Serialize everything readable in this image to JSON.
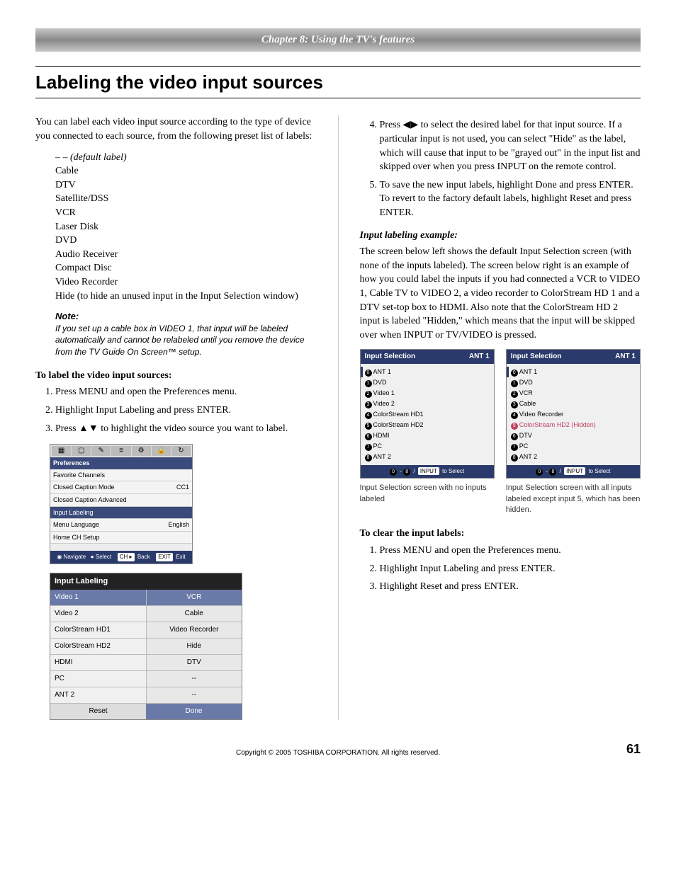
{
  "chapter_banner": "Chapter 8: Using the TV's features",
  "title": "Labeling the video input sources",
  "intro": "You can label each video input source according to the type of device you connected to each source, from the following preset list of labels:",
  "labels": [
    "– – (default label)",
    "Cable",
    "DTV",
    "Satellite/DSS",
    "VCR",
    "Laser Disk",
    "DVD",
    "Audio Receiver",
    "Compact Disc",
    "Video Recorder",
    "Hide (to hide an unused input in the Input Selection window)"
  ],
  "note_head": "Note:",
  "note_body": "If you set up a cable box in VIDEO 1, that input will be labeled automatically and cannot be relabeled until you remove the device from the TV Guide On Screen™ setup.",
  "label_heading": "To label the video input sources:",
  "label_steps": [
    "Press MENU and open the Preferences menu.",
    "Highlight Input Labeling and press ENTER.",
    "Press ▲▼ to highlight the video source you want to label."
  ],
  "prefs": {
    "title": "Preferences",
    "rows": [
      {
        "l": "Favorite Channels",
        "r": ""
      },
      {
        "l": "Closed Caption Mode",
        "r": "CC1"
      },
      {
        "l": "Closed Caption Advanced",
        "r": ""
      },
      {
        "l": "Input Labeling",
        "r": "",
        "sel": true
      },
      {
        "l": "Menu Language",
        "r": "English"
      },
      {
        "l": "Home CH Setup",
        "r": ""
      }
    ],
    "footer_nav": "Navigate",
    "footer_sel": "Select",
    "footer_back": "Back",
    "footer_exit": "Exit"
  },
  "il": {
    "title": "Input Labeling",
    "rows": [
      {
        "l": "Video 1",
        "r": "VCR",
        "sel": true
      },
      {
        "l": "Video 2",
        "r": "Cable"
      },
      {
        "l": "ColorStream HD1",
        "r": "Video Recorder"
      },
      {
        "l": "ColorStream HD2",
        "r": "Hide"
      },
      {
        "l": "HDMI",
        "r": "DTV"
      },
      {
        "l": "PC",
        "r": "--"
      },
      {
        "l": "ANT 2",
        "r": "--"
      }
    ],
    "reset": "Reset",
    "done": "Done"
  },
  "step4": "Press ◀▶ to select the desired label for that input source. If a particular input is not used, you can select \"Hide\" as the label, which will cause that input to be \"grayed out\" in the input list and skipped over when you press INPUT on the remote control.",
  "step5": "To save the new input labels, highlight Done and press ENTER.  To revert to the factory default labels, highlight Reset and press ENTER.",
  "ex_head": "Input labeling example:",
  "ex_body": "The screen below left shows the default Input Selection screen (with none of the inputs labeled). The screen below right is an example of how you could label the inputs if you had connected a VCR to VIDEO 1, Cable TV to VIDEO 2, a video recorder to ColorStream HD 1 and a DTV set-top box to HDMI. Also note that the ColorStream HD 2 input is labeled \"Hidden,\" which means that the input will be skipped over when INPUT or TV/VIDEO is pressed.",
  "sel_title": "Input Selection",
  "sel_ant": "ANT 1",
  "sel_left": [
    "ANT 1",
    "DVD",
    "Video 1",
    "Video 2",
    "ColorStream HD1",
    "ColorStream HD2",
    "HDMI",
    "PC",
    "ANT 2"
  ],
  "sel_right": [
    "ANT 1",
    "DVD",
    "VCR",
    "Cable",
    "Video Recorder",
    "ColorStream HD2 (Hidden)",
    "DTV",
    "PC",
    "ANT 2"
  ],
  "sel_footer": "to Select",
  "sel_foot_badge": "INPUT",
  "cap_left": "Input Selection screen with no inputs labeled",
  "cap_right": "Input Selection screen with all inputs labeled except input 5, which has been hidden.",
  "clear_head": "To clear the input labels:",
  "clear_steps": [
    "Press MENU and open the Preferences menu.",
    "Highlight Input Labeling and press ENTER.",
    "Highlight Reset and press ENTER."
  ],
  "copyright": "Copyright © 2005 TOSHIBA CORPORATION. All rights reserved.",
  "page": "61"
}
